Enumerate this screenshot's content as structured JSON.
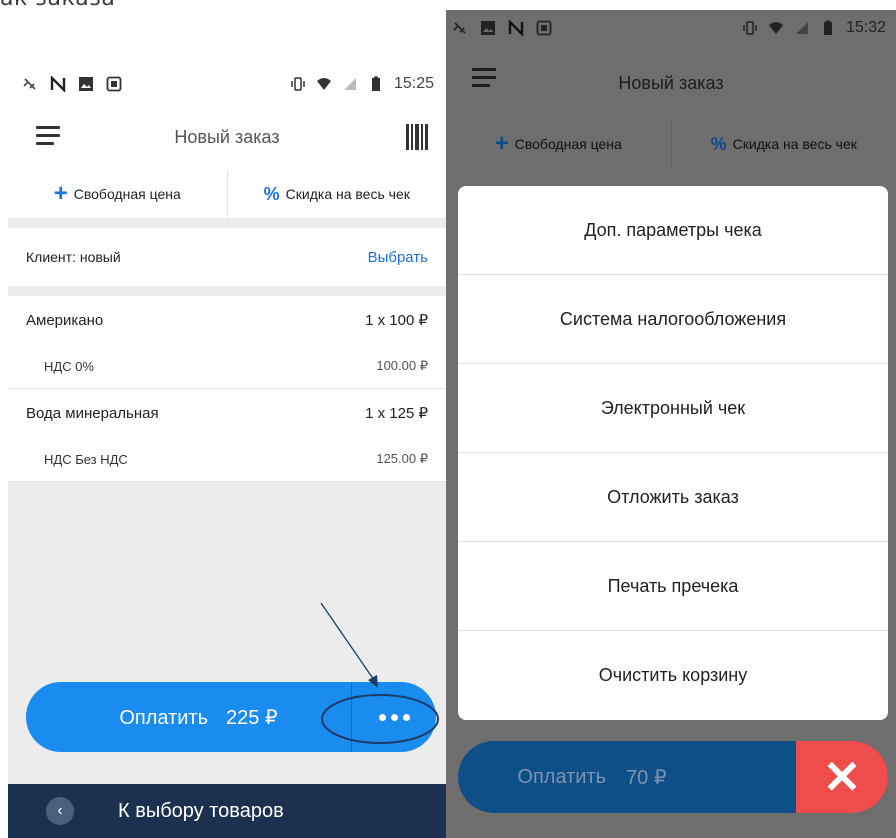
{
  "caption": "ак заказа",
  "left": {
    "status": {
      "time": "15:25"
    },
    "appbar": {
      "title": "Новый заказ"
    },
    "actions": {
      "free_price": "Свободная цена",
      "discount": "Скидка на весь чек"
    },
    "client": {
      "label": "Клиент: новый",
      "select": "Выбрать"
    },
    "items": [
      {
        "name": "Американо",
        "qty_price": "1 x 100 ₽",
        "tax": "НДС 0%",
        "sum": "100.00 ₽"
      },
      {
        "name": "Вода минеральная",
        "qty_price": "1 x 125 ₽",
        "tax": "НДС Без НДС",
        "sum": "125.00 ₽"
      }
    ],
    "pay": {
      "label": "Оплатить",
      "amount": "225 ₽"
    },
    "bottom_nav": {
      "label": "К выбору товаров"
    }
  },
  "right": {
    "status": {
      "time": "15:32"
    },
    "appbar": {
      "title": "Новый заказ"
    },
    "actions": {
      "free_price": "Свободная цена",
      "discount": "Скидка на весь чек"
    },
    "menu": [
      "Доп. параметры чека",
      "Система налогообложения",
      "Электронный чек",
      "Отложить заказ",
      "Печать пречека",
      "Очистить корзину"
    ],
    "pay": {
      "label": "Оплатить",
      "amount": "70 ₽"
    }
  },
  "colors": {
    "accent": "#1a8cf0",
    "link": "#1a73d9",
    "nav_bg": "#1c3150",
    "close": "#ef4c4c"
  }
}
